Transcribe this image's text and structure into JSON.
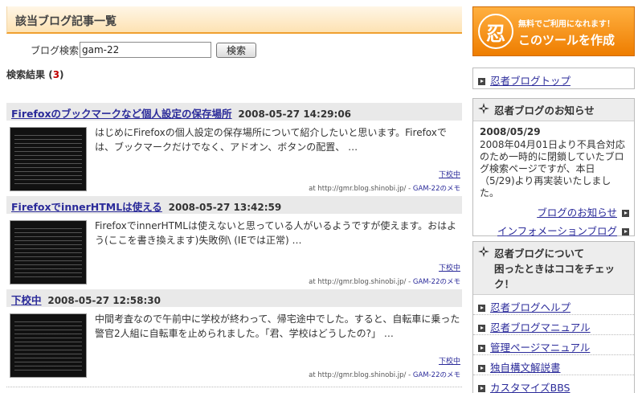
{
  "main": {
    "heading": "該当ブログ記事一覧",
    "search": {
      "label": "ブログ検索",
      "value": "gam-22",
      "button": "検索"
    },
    "result": {
      "label": "検索結果",
      "open": " (",
      "count": "3",
      "close": ")"
    },
    "entries": [
      {
        "title": "Firefoxのブックマークなど個人設定の保存場所",
        "date": "2008-05-27 14:29:06",
        "text": "はじめにFirefoxの個人設定の保存場所について紹介したいと思います。Firefoxでは、ブックマークだけでなく、アドオン、ボタンの配置、 …",
        "category": "下校中",
        "source": "at http://gmr.blog.shinobi.jp/ - ",
        "author": "GAM-22のメモ"
      },
      {
        "title": "FirefoxでinnerHTMLは使える",
        "date": "2008-05-27 13:42:59",
        "text": "FirefoxでinnerHTMLは使えないと思っている人がいるようですが使えます。おはよう(ここを書き換えます)失敗例\\ (IEでは正常) …",
        "category": "下校中",
        "source": "at http://gmr.blog.shinobi.jp/ - ",
        "author": "GAM-22のメモ"
      },
      {
        "title": "下校中",
        "date": "2008-05-27 12:58:30",
        "text": "中間考査なので午前中に学校が終わって、帰宅途中でした。すると、自転車に乗った警官2人組に自転車を止められました。「君、学校はどうしたの?」 …",
        "category": "下校中",
        "source": "at http://gmr.blog.shinobi.jp/ - ",
        "author": "GAM-22のメモ"
      }
    ]
  },
  "sidebar": {
    "banner": {
      "logo": "忍",
      "line1": "無料でご利用になれます！",
      "line2": "このツールを作成"
    },
    "top_link": "忍者ブログトップ",
    "news": {
      "heading": "忍者ブログのお知らせ",
      "date": "2008/05/29",
      "text": "2008年04月01日より不具合対応のため一時的に閉鎖していたブログ検索ページですが、本日（5/29)より再実装いたしました。",
      "links": [
        "ブログのお知らせ",
        "インフォメーションブログ"
      ]
    },
    "help": {
      "heading_line1": "忍者ブログについて",
      "heading_line2": "困ったときはココをチェック！",
      "links": [
        "忍者ブログヘルプ",
        "忍者ブログマニュアル",
        "管理ページマニュアル",
        "独自構文解説書",
        "カスタマイズBBS"
      ]
    }
  }
}
